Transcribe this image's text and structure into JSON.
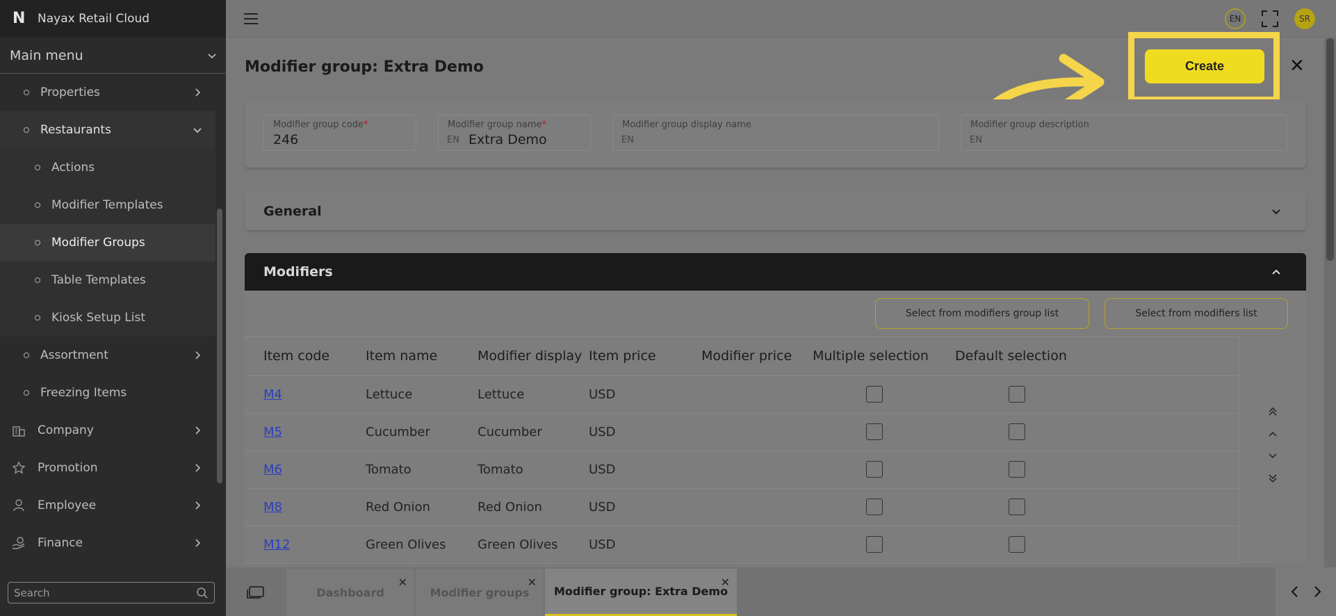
{
  "app": {
    "name": "Nayax Retail Cloud",
    "logo_letter": "N"
  },
  "sidebar": {
    "main_menu_label": "Main menu",
    "items": [
      {
        "label": "Properties",
        "level": 1,
        "chevron": "right"
      },
      {
        "label": "Restaurants",
        "level": 1,
        "chevron": "down"
      },
      {
        "label": "Actions",
        "level": 2
      },
      {
        "label": "Modifier Templates",
        "level": 2
      },
      {
        "label": "Modifier Groups",
        "level": 2,
        "active": true
      },
      {
        "label": "Table Templates",
        "level": 2
      },
      {
        "label": "Kiosk Setup List",
        "level": 2
      },
      {
        "label": "Assortment",
        "level": 1,
        "chevron": "right"
      },
      {
        "label": "Freezing Items",
        "level": 1
      },
      {
        "label": "Company",
        "icon": "building-icon",
        "chevron": "right"
      },
      {
        "label": "Promotion",
        "icon": "star-icon",
        "chevron": "right"
      },
      {
        "label": "Employee",
        "icon": "person-icon",
        "chevron": "right"
      },
      {
        "label": "Finance",
        "icon": "hand-coin-icon",
        "chevron": "right"
      }
    ],
    "search_placeholder": "Search"
  },
  "topbar": {
    "language": "EN",
    "user_initials": "SR"
  },
  "page": {
    "title": "Modifier group: Extra Demo",
    "create_label": "Create",
    "fields": {
      "code_label": "Modifier group code",
      "code_value": "246",
      "name_label": "Modifier group name",
      "name_lang": "EN",
      "name_value": "Extra Demo",
      "display_label": "Modifier group display name",
      "display_lang": "EN",
      "description_label": "Modifier group description",
      "description_lang": "EN"
    },
    "general_section": "General",
    "modifiers_section": "Modifiers",
    "select_group_list": "Select from modifiers group list",
    "select_modifiers_list": "Select from modifiers list"
  },
  "table": {
    "headers": [
      "Item code",
      "Item name",
      "Modifier display",
      "Item price",
      "Modifier price",
      "Multiple selection",
      "Default selection"
    ],
    "rows": [
      {
        "code": "M4",
        "name": "Lettuce",
        "display": "Lettuce",
        "price": "USD"
      },
      {
        "code": "M5",
        "name": "Cucumber",
        "display": "Cucumber",
        "price": "USD"
      },
      {
        "code": "M6",
        "name": "Tomato",
        "display": "Tomato",
        "price": "USD"
      },
      {
        "code": "M8",
        "name": "Red Onion",
        "display": "Red Onion",
        "price": "USD"
      },
      {
        "code": "M12",
        "name": "Green Olives",
        "display": "Green Olives",
        "price": "USD"
      }
    ]
  },
  "tabs": [
    {
      "label": "Dashboard"
    },
    {
      "label": "Modifier groups"
    },
    {
      "label": "Modifier group: Extra Demo",
      "active": true
    }
  ],
  "colors": {
    "accent": "#f0dc1f",
    "highlight": "#f5d54a",
    "sidebar": "#2b2b2b",
    "link": "#2a3fc0"
  }
}
